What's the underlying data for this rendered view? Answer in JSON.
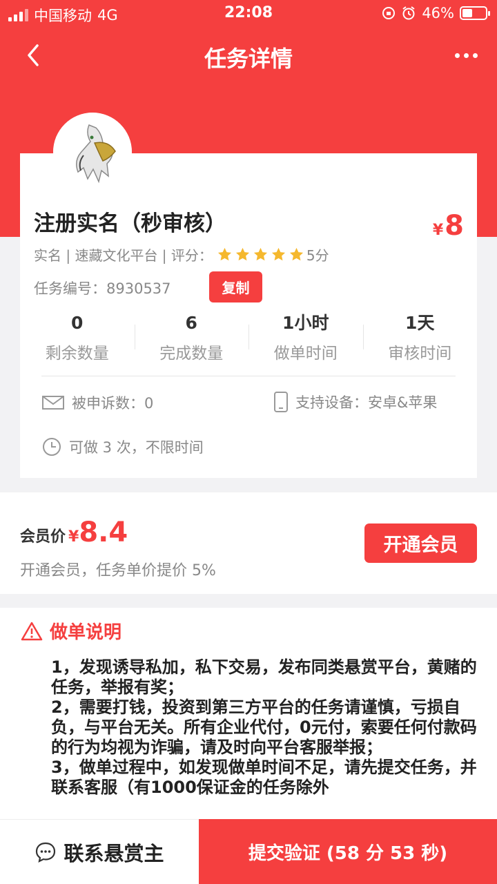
{
  "status_bar": {
    "carrier": "中国移动",
    "network": "4G",
    "time": "22:08",
    "battery": "46%",
    "battery_level": 0.46,
    "icons": [
      "signal-icon",
      "lock-rotation-icon",
      "alarm-icon",
      "battery-icon"
    ]
  },
  "header": {
    "title": "任务详情",
    "back_icon": "chevron-left-icon",
    "more_icon": "more-dots-icon"
  },
  "task": {
    "title": "注册实名（秒审核）",
    "price_symbol": "¥",
    "price": "8",
    "meta_prefix": "实名 | 速藏文化平台 | 评分：",
    "rating_stars": 5,
    "rating_text": "5分",
    "task_id_label": "任务编号：",
    "task_id": "8930537",
    "copy_label": "复制",
    "stats": [
      {
        "value": "0",
        "label": "剩余数量"
      },
      {
        "value": "6",
        "label": "完成数量"
      },
      {
        "value": "1小时",
        "label": "做单时间"
      },
      {
        "value": "1天",
        "label": "审核时间"
      }
    ],
    "complaints_label": "被申诉数：0",
    "devices_label": "支持设备：安卓&苹果",
    "limit_label": "可做 3 次，不限时间"
  },
  "member": {
    "label": "会员价",
    "symbol": "¥",
    "price": "8.4",
    "note": "开通会员，任务单价提价 5%",
    "button": "开通会员"
  },
  "notes": {
    "title": "做单说明",
    "items": [
      "1，发现诱导私加，私下交易，发布同类悬赏平台，黄赌的任务，举报有奖；",
      "2，需要打钱，投资到第三方平台的任务请谨慎，亏损自负，与平台无关。所有企业代付，0元付，索要任何付款码的行为均视为诈骗，请及时向平台客服举报；",
      "3，做单过程中，如发现做单时间不足，请先提交任务，并联系客服（有1000保证金的任务除外"
    ]
  },
  "bottom": {
    "contact": "联系悬赏主",
    "submit": "提交验证 (58 分 53 秒)"
  },
  "colors": {
    "brand": "#f53f3f",
    "star": "#f5b82e"
  }
}
